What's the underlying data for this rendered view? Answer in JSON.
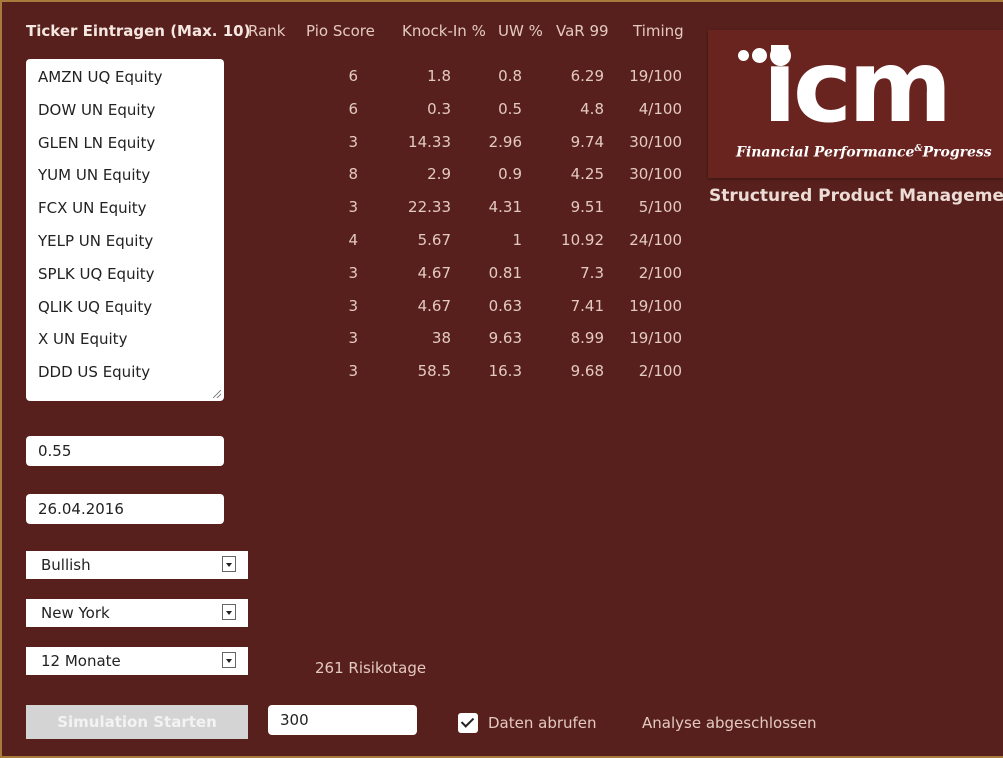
{
  "headers": {
    "ticker": "Ticker Eintragen (Max. 10)",
    "rank": "Rank",
    "pio": "Pio Score",
    "knockin": "Knock-In %",
    "uw": "UW %",
    "var": "VaR 99",
    "timing": "Timing"
  },
  "tickers": [
    "AMZN UQ Equity",
    "DOW UN Equity",
    "GLEN LN Equity",
    "YUM UN Equity",
    "FCX UN Equity",
    "YELP UN Equity",
    "SPLK UQ Equity",
    "QLIK UQ Equity",
    "X UN Equity",
    "DDD US Equity"
  ],
  "pio_scores": [
    "6",
    "6",
    "3",
    "8",
    "3",
    "4",
    "3",
    "3",
    "3",
    "3"
  ],
  "knockin": [
    "1.8",
    "0.3",
    "14.33",
    "2.9",
    "22.33",
    "5.67",
    "4.67",
    "4.67",
    "38",
    "58.5"
  ],
  "uw": [
    "0.8",
    "0.5",
    "2.96",
    "0.9",
    "4.31",
    "1",
    "0.81",
    "0.63",
    "9.63",
    "16.3"
  ],
  "var99": [
    "6.29",
    "4.8",
    "9.74",
    "4.25",
    "9.51",
    "10.92",
    "7.3",
    "7.41",
    "8.99",
    "9.68"
  ],
  "timing": [
    "19/100",
    "4/100",
    "30/100",
    "30/100",
    "5/100",
    "24/100",
    "2/100",
    "19/100",
    "19/100",
    "2/100"
  ],
  "inputs": {
    "level": "0.55",
    "date": "26.04.2016",
    "simulations": "300"
  },
  "selects": {
    "sentiment": "Bullish",
    "market": "New York",
    "period": "12 Monate"
  },
  "risk_days": "261 Risikotage",
  "simulate_label": "Simulation Starten",
  "fetch_label": "Daten abrufen",
  "fetch_checked": true,
  "status": "Analyse abgeschlossen",
  "logo": {
    "text": "icm",
    "tagline_a": "Financial Performance",
    "tagline_amp": "&",
    "tagline_b": "Progress"
  },
  "brand_subtitle": "Structured Product Management",
  "colors": {
    "background": "#58201c",
    "logo_panel": "#6a2420",
    "frame": "#a87a3c"
  }
}
